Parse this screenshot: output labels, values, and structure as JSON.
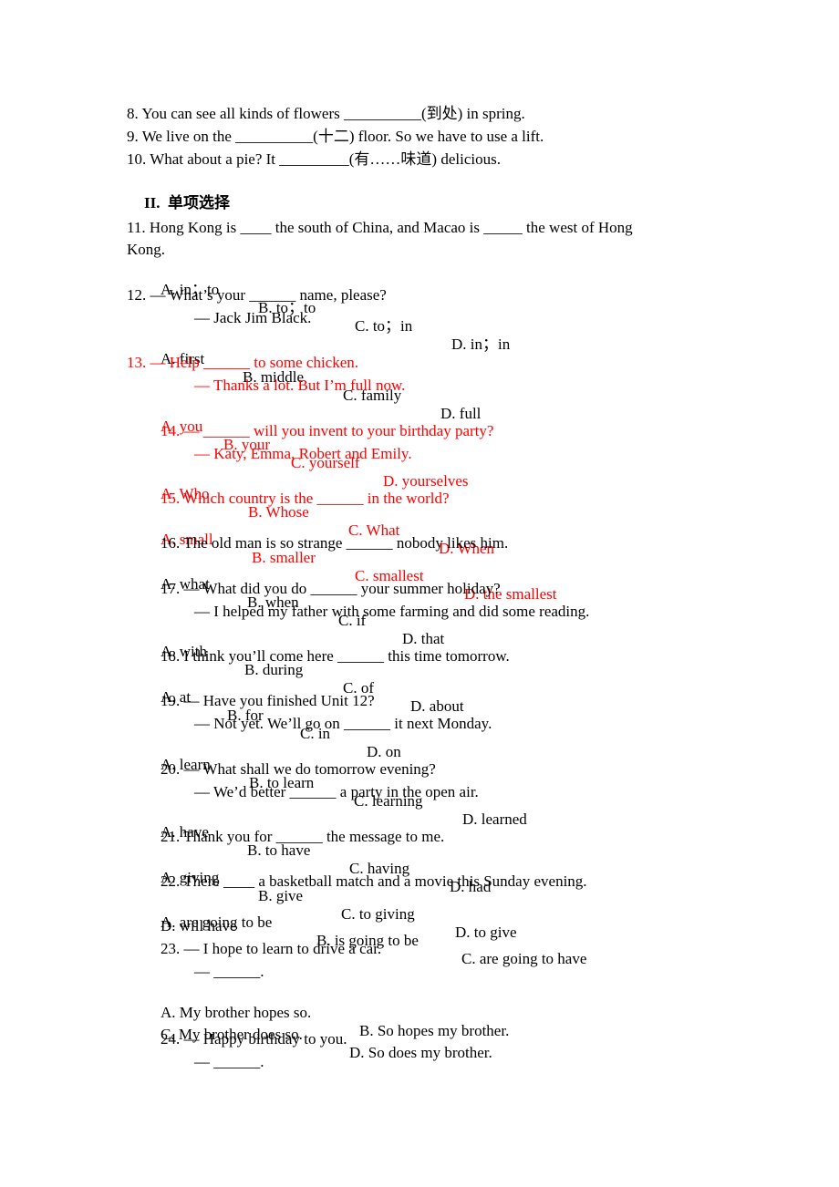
{
  "colors": {
    "text": "#000000",
    "highlight": "#ff0000",
    "background": "#ffffff"
  },
  "fill_in": [
    {
      "text": "8. You can see all kinds of flowers __________(到处) in spring."
    },
    {
      "text": "9. We live on the __________(十二) floor. So we have to use a lift."
    },
    {
      "text": "10. What about a pie? It _________(有……味道) delicious."
    }
  ],
  "section_title": "II.  单项选择",
  "questions": {
    "q11": {
      "line1": "11. Hong Kong is ____ the south of China, and Macao is _____ the west of Hong",
      "line2": "Kong.",
      "options": [
        "A. in；to",
        "B. to；to",
        "C. to；in",
        "D. in；in"
      ]
    },
    "q12": {
      "line1": "12. — What’s your ______ name, please?",
      "line2": "— Jack Jim Black.",
      "options": [
        "A. first",
        "B. middle",
        "C. family",
        "D. full"
      ]
    },
    "q13": {
      "line1": "13. — Help ______ to some chicken.",
      "line2": "— Thanks a lot. But I’m full now.",
      "options": [
        "A. you",
        "B. your",
        "C. yourself",
        "D. yourselves"
      ]
    },
    "q14": {
      "line1": "14. — ______ will you invent to your birthday party?",
      "line2": "— Katy, Emma, Robert and Emily.",
      "options": [
        "A. Who",
        "B. Whose",
        "C. What",
        "D. When"
      ]
    },
    "q15": {
      "line1": "15. Which country is the ______ in the world?",
      "options": [
        "A. small",
        "B. smaller",
        "C. smallest",
        "D. the smallest"
      ]
    },
    "q16": {
      "line1": "16. The old man is so strange ______ nobody likes him.",
      "options": [
        "A. what",
        "B. when",
        "C. if",
        "D. that"
      ]
    },
    "q17": {
      "line1": "17. — What did you do ______ your summer holiday?",
      "line2": "— I helped my father with some farming and did some reading.",
      "options": [
        "A. with",
        "B. during",
        "C. of",
        "D. about"
      ]
    },
    "q18": {
      "line1": "18. I think you’ll come here ______ this time tomorrow.",
      "options": [
        "A. at",
        "B. for",
        "C. in",
        "D. on"
      ]
    },
    "q19": {
      "line1": "19. — Have you finished Unit 12?",
      "line2": "— Not yet. We’ll go on ______ it next Monday.",
      "options": [
        "A. learn",
        "B. to learn",
        "C. learning",
        "D. learned"
      ]
    },
    "q20": {
      "line1": "20. — What shall we do tomorrow evening?",
      "line2": "— We’d better ______ a party in the open air.",
      "options": [
        "A. have",
        "B. to have",
        "C. having",
        "D. had"
      ]
    },
    "q21": {
      "line1": "21. Thank you for ______ the message to me.",
      "options": [
        "A. giving",
        "B. give",
        "C. to giving",
        "D. to give"
      ]
    },
    "q22": {
      "line1": "22. There ____ a basketball match and a movie this Sunday evening.",
      "options": [
        "A. are going to be",
        "B. is going to be",
        "C. are going to have",
        "D. will have"
      ]
    },
    "q23": {
      "line1": "23. — I hope to learn to drive a car.",
      "line2": "— ______.",
      "options": [
        "A. My brother hopes so.",
        "B. So hopes my brother.",
        "C. My brother does so.",
        "D. So does my brother."
      ]
    },
    "q24": {
      "line1": "24. — Happy birthday to you.",
      "line2": "— ______."
    }
  }
}
